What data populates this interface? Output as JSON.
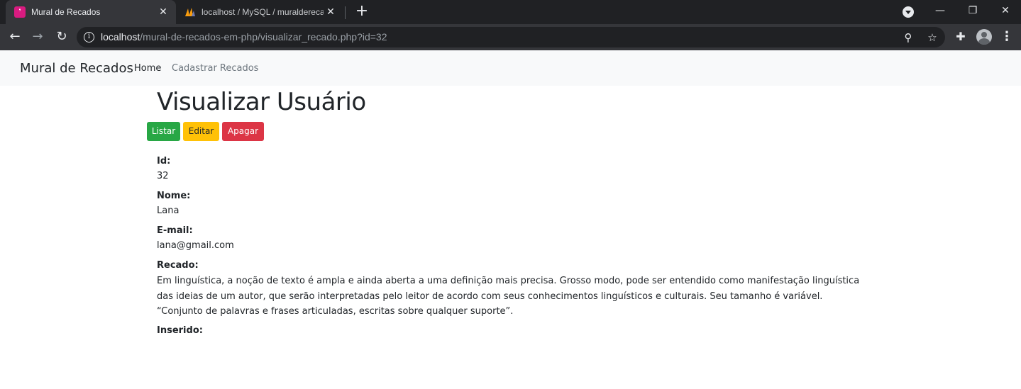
{
  "browser": {
    "tabs": [
      {
        "title": "Mural de Recados",
        "favicon": "app-icon",
        "active": true
      },
      {
        "title": "localhost / MySQL / muralderecados",
        "favicon": "phpmyadmin-icon",
        "active": false
      }
    ],
    "url_host": "localhost",
    "url_path": "/mural-de-recados-em-php/visualizar_recado.php?id=32"
  },
  "navbar": {
    "brand": "Mural de Recados",
    "links": [
      {
        "label": "Home"
      },
      {
        "label": "Cadastrar Recados"
      }
    ]
  },
  "page": {
    "title": "Visualizar Usuário",
    "buttons": {
      "listar": "Listar",
      "editar": "Editar",
      "apagar": "Apagar"
    },
    "fields": {
      "id_label": "Id:",
      "id_value": "32",
      "nome_label": "Nome:",
      "nome_value": "Lana",
      "email_label": "E-mail:",
      "email_value": "lana@gmail.com",
      "recado_label": "Recado:",
      "recado_value": "Em linguística, a noção de texto é ampla e ainda aberta a uma definição mais precisa. Grosso modo, pode ser entendido como manifestação linguística das ideias de um autor, que serão interpretadas pelo leitor de acordo com seus conhecimentos linguísticos e culturais. Seu tamanho é variável. “Conjunto de palavras e frases articuladas, escritas sobre qualquer suporte”.",
      "inserido_label": "Inserido:"
    }
  },
  "colors": {
    "success": "#28a745",
    "warning": "#ffc107",
    "danger": "#dc3545",
    "navbar_bg": "#f8f9fa"
  }
}
